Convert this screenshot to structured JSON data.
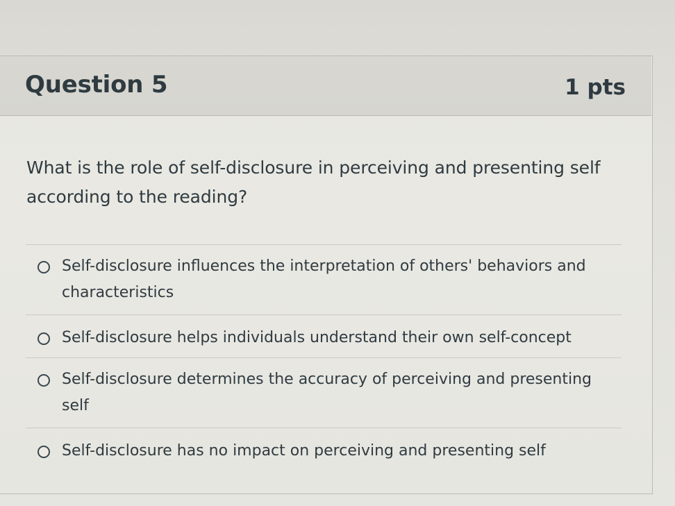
{
  "question": {
    "title": "Question 5",
    "points": "1 pts",
    "prompt": "What is the role of self-disclosure in perceiving and presenting self according to the reading?",
    "answers": [
      {
        "label": "Self-disclosure influences the interpretation of others' behaviors and characteristics"
      },
      {
        "label": "Self-disclosure helps individuals understand their own self-concept"
      },
      {
        "label": "Self-disclosure determines the accuracy of perceiving and presenting self"
      },
      {
        "label": "Self-disclosure has no impact on perceiving and presenting self"
      }
    ]
  },
  "colors": {
    "text": "#2f3b41",
    "header_background": "#d6d5cf",
    "border": "#b8bab7"
  },
  "icons": {
    "answer_control": "radio-button-icon"
  }
}
